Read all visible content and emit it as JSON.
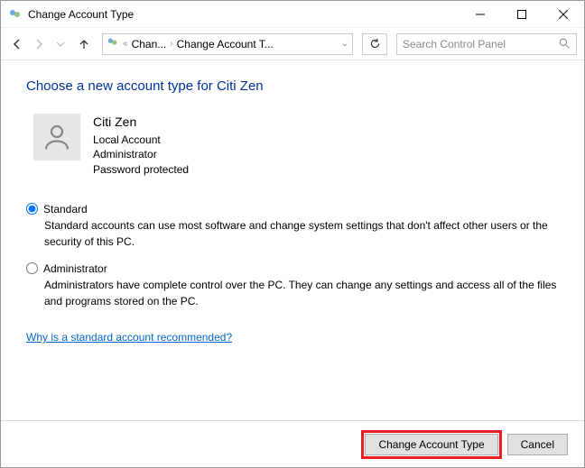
{
  "window": {
    "title": "Change Account Type"
  },
  "breadcrumb": {
    "item1": "Chan...",
    "item2": "Change Account T..."
  },
  "search": {
    "placeholder": "Search Control Panel"
  },
  "page": {
    "heading": "Choose a new account type for Citi Zen"
  },
  "user": {
    "name": "Citi Zen",
    "type": "Local Account",
    "role": "Administrator",
    "pw": "Password protected"
  },
  "options": {
    "standard": {
      "label": "Standard",
      "desc": "Standard accounts can use most software and change system settings that don't affect other users or the security of this PC."
    },
    "admin": {
      "label": "Administrator",
      "desc": "Administrators have complete control over the PC. They can change any settings and access all of the files and programs stored on the PC."
    }
  },
  "help": {
    "link": "Why is a standard account recommended?"
  },
  "buttons": {
    "change": "Change Account Type",
    "cancel": "Cancel"
  }
}
